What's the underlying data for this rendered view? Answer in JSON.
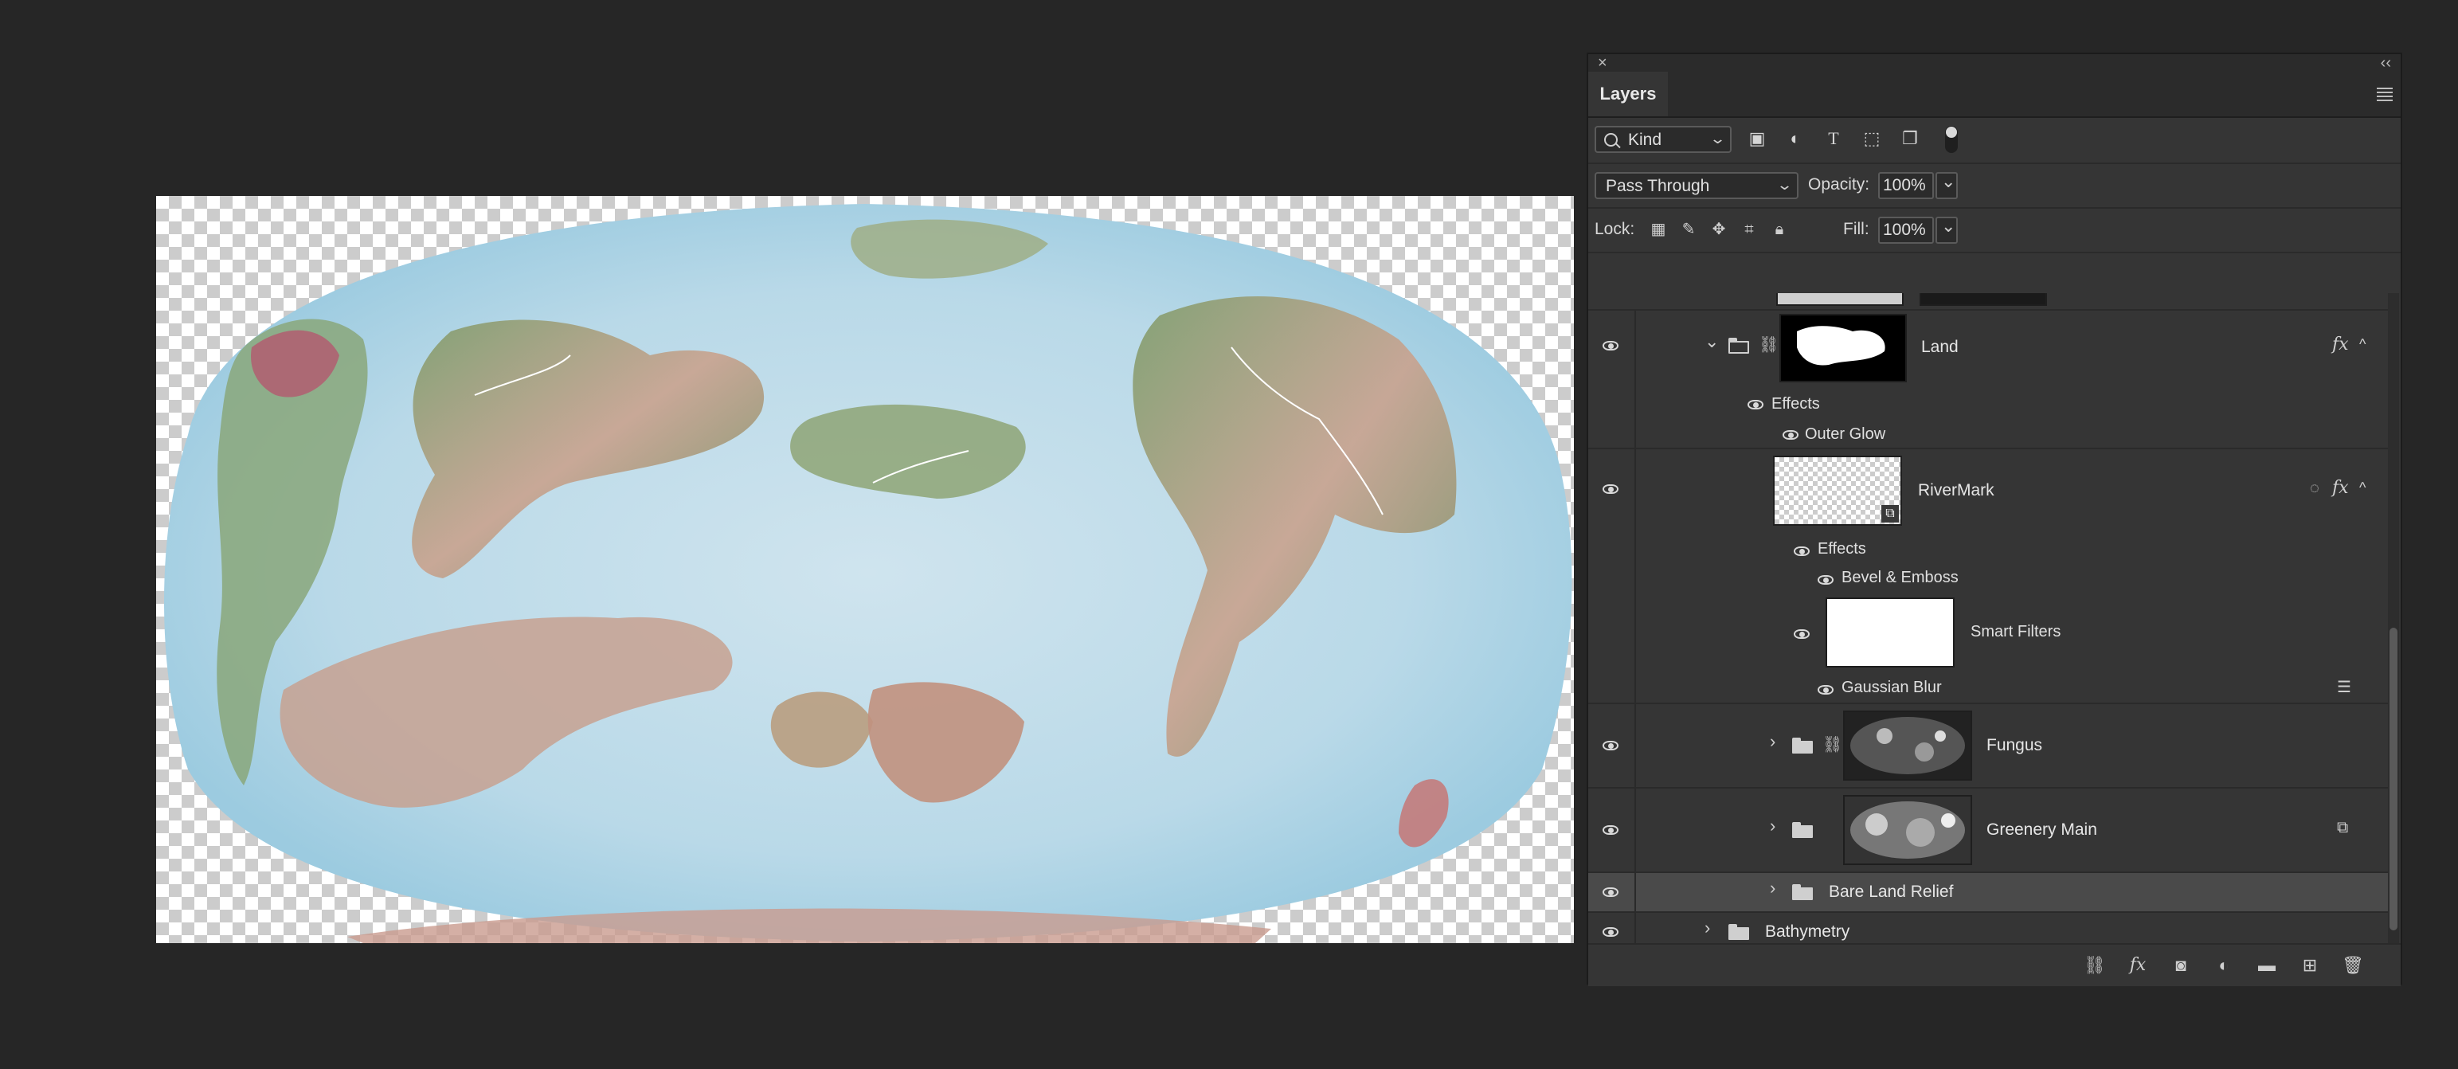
{
  "panel": {
    "tab_label": "Layers",
    "filter": {
      "kind_label": "Kind"
    },
    "blend_mode": "Pass Through",
    "opacity_label": "Opacity:",
    "opacity_value": "100%",
    "lock_label": "Lock:",
    "fill_label": "Fill:",
    "fill_value": "100%"
  },
  "layers": {
    "land": {
      "name": "Land",
      "effects_label": "Effects",
      "effect1": "Outer Glow"
    },
    "rivermark": {
      "name": "RiverMark",
      "effects_label": "Effects",
      "effect1": "Bevel & Emboss",
      "smart_filters": "Smart Filters",
      "filter1": "Gaussian Blur"
    },
    "fungus": {
      "name": "Fungus"
    },
    "greenery": {
      "name": "Greenery Main"
    },
    "bare": {
      "name": "Bare Land Relief"
    },
    "bathymetry": {
      "name": "Bathymetry"
    }
  },
  "icons": {
    "eye": "eye-icon",
    "folder": "folder-icon",
    "link": "link-icon",
    "fx": "fx-icon",
    "search": "search-icon"
  }
}
